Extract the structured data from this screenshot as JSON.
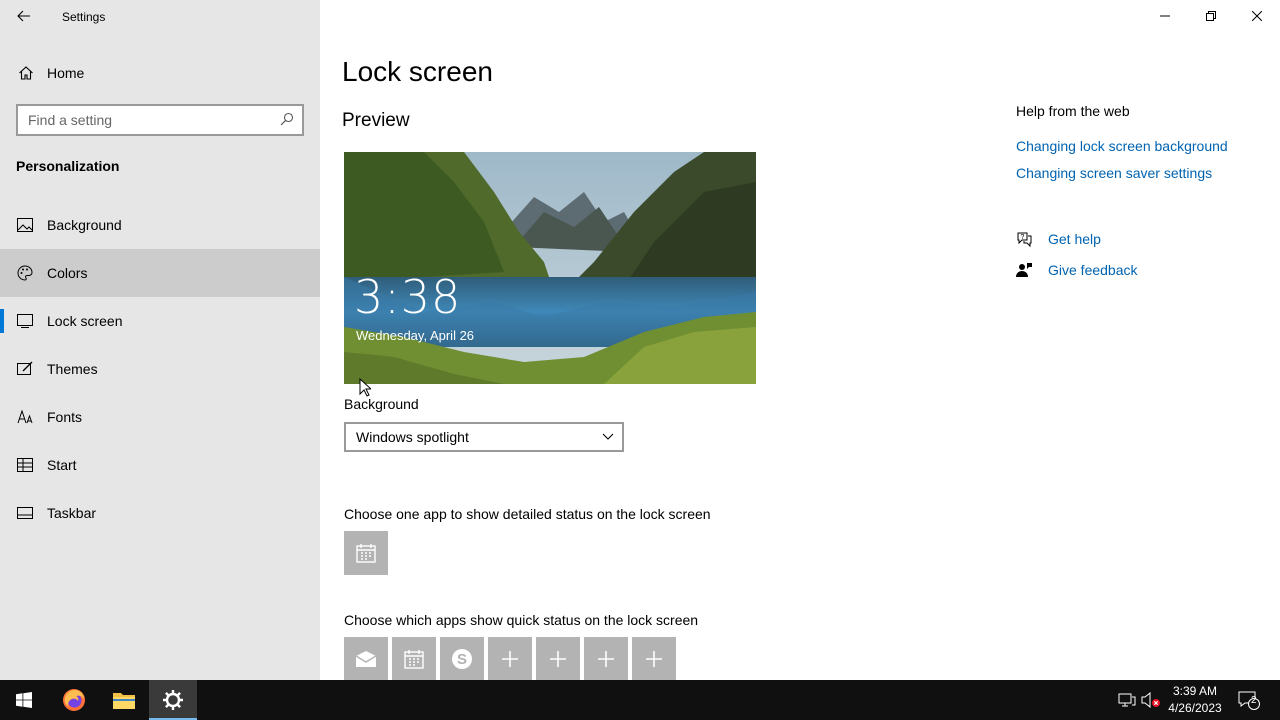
{
  "window": {
    "app_title": "Settings",
    "back_icon": "arrow-left-icon",
    "controls": [
      "minimize-icon",
      "restore-icon",
      "close-icon"
    ]
  },
  "sidebar": {
    "home_label": "Home",
    "search_placeholder": "Find a setting",
    "section_title": "Personalization",
    "items": [
      {
        "label": "Background",
        "icon": "picture-icon",
        "state": "normal"
      },
      {
        "label": "Colors",
        "icon": "palette-icon",
        "state": "hover"
      },
      {
        "label": "Lock screen",
        "icon": "lock-screen-icon",
        "state": "selected"
      },
      {
        "label": "Themes",
        "icon": "brush-icon",
        "state": "normal"
      },
      {
        "label": "Fonts",
        "icon": "font-icon",
        "state": "normal"
      },
      {
        "label": "Start",
        "icon": "start-icon",
        "state": "normal"
      },
      {
        "label": "Taskbar",
        "icon": "taskbar-icon",
        "state": "normal"
      }
    ]
  },
  "main": {
    "title": "Lock screen",
    "preview_heading": "Preview",
    "preview_time": "3:38",
    "preview_date": "Wednesday, April 26",
    "background_label": "Background",
    "background_value": "Windows spotlight",
    "detailed_status_label": "Choose one app to show detailed status on the lock screen",
    "quick_status_label": "Choose which apps show quick status on the lock screen",
    "quick_status_tiles": [
      "mail-icon",
      "calendar-icon",
      "skype-icon",
      "plus-icon",
      "plus-icon",
      "plus-icon",
      "plus-icon"
    ]
  },
  "help": {
    "heading": "Help from the web",
    "links": [
      "Changing lock screen background",
      "Changing screen saver settings"
    ],
    "get_help": "Get help",
    "give_feedback": "Give feedback"
  },
  "taskbar": {
    "time": "3:39 AM",
    "date": "4/26/2023",
    "notification_count": "2"
  },
  "colors": {
    "accent": "#0078d7",
    "link": "#0063b1",
    "sidebar_bg": "#e6e6e6",
    "taskbar_bg": "#101010"
  }
}
